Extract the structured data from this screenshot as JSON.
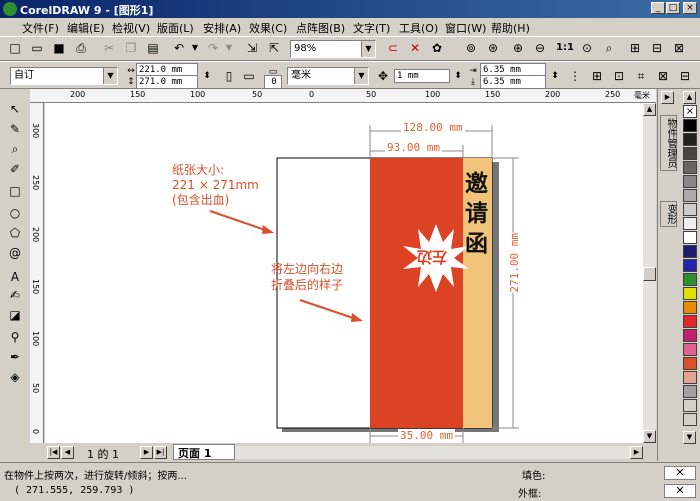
{
  "window": {
    "title": "CorelDRAW 9 - [图形1]",
    "min": "_",
    "max": "□",
    "close": "×"
  },
  "menu": [
    "文件(F)",
    "编辑(E)",
    "检视(V)",
    "版面(L)",
    "安排(A)",
    "效果(C)",
    "点阵图(B)",
    "文字(T)",
    "工具(O)",
    "窗口(W)",
    "帮助(H)"
  ],
  "toolbar": {
    "zoom_value": "98%"
  },
  "propbar": {
    "preset": "自订",
    "width": "221.0 mm",
    "height": "271.0 mm",
    "dup_count": "0",
    "units": "毫米",
    "nudge": "1 mm",
    "offset_x": "6.35 mm",
    "offset_y": "6.35 mm"
  },
  "ruler": {
    "h_labels": [
      "200",
      "150",
      "100",
      "50",
      "0",
      "50",
      "100",
      "150",
      "200",
      "250"
    ],
    "unit": "毫米",
    "v_labels": [
      "300",
      "250",
      "200",
      "150",
      "100",
      "50",
      "0"
    ]
  },
  "drawing": {
    "dim_total": "128.00 mm",
    "dim_red": "93.00 mm",
    "dim_bottom": "35.00 mm",
    "dim_height": "271.00 mm",
    "note1": [
      "纸张大小:",
      "221 × 271mm",
      "(包含出血)"
    ],
    "note2": [
      "将左边向右边",
      "折叠后的样子"
    ],
    "burst_text": "左边",
    "invite": [
      "邀",
      "请",
      "函"
    ],
    "colors": {
      "red": "#dc4224",
      "tan": "#f2c47a",
      "annot": "#d9502a"
    }
  },
  "pagenav": {
    "pages": "1 的 1",
    "tab": "页面 1"
  },
  "docker": {
    "tab1": "物件管理员",
    "tab2": "变形"
  },
  "palette": [
    "#ffffff",
    "#000000",
    "#222222",
    "#444444",
    "#666666",
    "#888888",
    "#aaaaaa",
    "#cccccc",
    "#eeeeee",
    "#ffffff",
    "#1a1a6e",
    "#2222aa",
    "#2f8f2f",
    "#dfdf00",
    "#e88a00",
    "#e0262e",
    "#c0206e",
    "#e06090",
    "#d9502a",
    "#e8a090",
    "#a0a0a0"
  ],
  "status": {
    "hint": "在物件上按两次，进行旋转/倾斜；按两...",
    "coords": "( 271.555, 259.793 )",
    "fill_label": "填色:",
    "outline_label": "外框:"
  }
}
